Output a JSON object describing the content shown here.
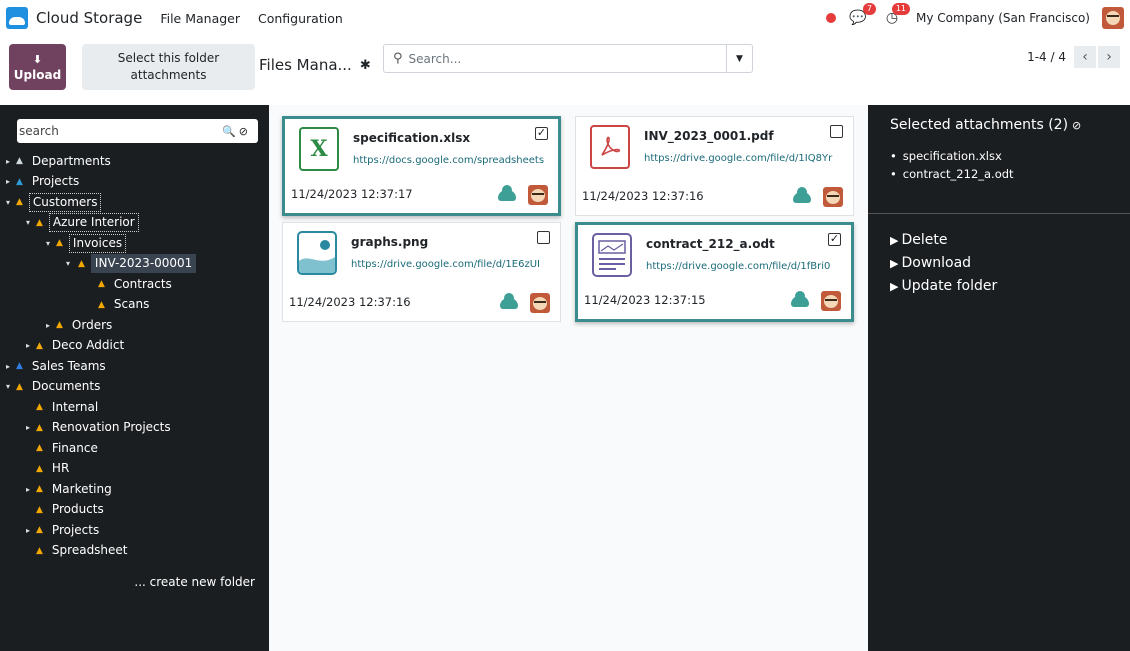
{
  "topnav": {
    "app_name": "Cloud Storage",
    "menus": [
      "File Manager",
      "Configuration"
    ],
    "messages_count": "7",
    "activities_count": "11",
    "company": "My Company (San Francisco)"
  },
  "control": {
    "upload_label": "Upload",
    "select_folder_label": "Select this folder attachments",
    "breadcrumb": "Files Mana...",
    "search_placeholder": "Search...",
    "pager_value": "1-4 / 4"
  },
  "sidebar": {
    "search_placeholder": "search",
    "create_folder": "... create new folder",
    "tree": [
      {
        "label": "Departments",
        "depth": 0,
        "caret": "▸",
        "color": "#cfd8dc"
      },
      {
        "label": "Projects",
        "depth": 0,
        "caret": "▸",
        "color": "#2e9bd6"
      },
      {
        "label": "Customers",
        "depth": 0,
        "caret": "▾",
        "color": "#f2a800",
        "boxed": true
      },
      {
        "label": "Azure Interior",
        "depth": 1,
        "caret": "▾",
        "color": "#f2a800",
        "boxed": true
      },
      {
        "label": "Invoices",
        "depth": 2,
        "caret": "▾",
        "color": "#f2a800",
        "boxed": true
      },
      {
        "label": "INV-2023-00001",
        "depth": 3,
        "caret": "▾",
        "color": "#f2a800",
        "active": true
      },
      {
        "label": "Contracts",
        "depth": 4,
        "caret": "",
        "color": "#f2a800"
      },
      {
        "label": "Scans",
        "depth": 4,
        "caret": "",
        "color": "#f2a800"
      },
      {
        "label": "Orders",
        "depth": 2,
        "caret": "▸",
        "color": "#f2a800"
      },
      {
        "label": "Deco Addict",
        "depth": 1,
        "caret": "▸",
        "color": "#f2a800"
      },
      {
        "label": "Sales Teams",
        "depth": 0,
        "caret": "▸",
        "color": "#2f7de1"
      },
      {
        "label": "Documents",
        "depth": 0,
        "caret": "▾",
        "color": "#f2a800"
      },
      {
        "label": "Internal",
        "depth": 1,
        "caret": "",
        "color": "#f2a800"
      },
      {
        "label": "Renovation Projects",
        "depth": 1,
        "caret": "▸",
        "color": "#f2a800"
      },
      {
        "label": "Finance",
        "depth": 1,
        "caret": "",
        "color": "#f2a800"
      },
      {
        "label": "HR",
        "depth": 1,
        "caret": "",
        "color": "#f2a800"
      },
      {
        "label": "Marketing",
        "depth": 1,
        "caret": "▸",
        "color": "#f2a800"
      },
      {
        "label": "Products",
        "depth": 1,
        "caret": "",
        "color": "#f2a800"
      },
      {
        "label": "Projects",
        "depth": 1,
        "caret": "▸",
        "color": "#f2a800"
      },
      {
        "label": "Spreadsheet",
        "depth": 1,
        "caret": "",
        "color": "#f2a800"
      }
    ]
  },
  "files": [
    {
      "name": "specification.xlsx",
      "url": "https://docs.google.com/spreadsheets",
      "date": "11/24/2023 12:37:17",
      "checked": true,
      "icon": "xlsx-icon"
    },
    {
      "name": "INV_2023_0001.pdf",
      "url": "https://drive.google.com/file/d/1IQ8Yr",
      "date": "11/24/2023 12:37:16",
      "checked": false,
      "icon": "pdf-icon"
    },
    {
      "name": "graphs.png",
      "url": "https://drive.google.com/file/d/1E6zUI",
      "date": "11/24/2023 12:37:16",
      "checked": false,
      "icon": "image-icon"
    },
    {
      "name": "contract_212_a.odt",
      "url": "https://drive.google.com/file/d/1fBri0",
      "date": "11/24/2023 12:37:15",
      "checked": true,
      "icon": "document-icon"
    }
  ],
  "selected": {
    "title": "Selected attachments (2)",
    "items": [
      "specification.xlsx",
      "contract_212_a.odt"
    ],
    "actions": [
      "Delete",
      "Download",
      "Update folder"
    ]
  }
}
